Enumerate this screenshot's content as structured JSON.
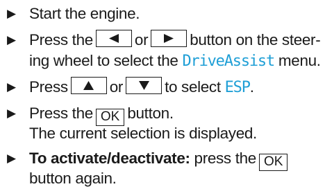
{
  "steps": [
    {
      "text": "Start the engine."
    },
    {
      "pre": "Press the",
      "key_left_icon": "triangle-left-icon",
      "or": "or",
      "key_right_icon": "triangle-right-icon",
      "post": "button on the steer-",
      "line2_pre": "ing wheel to select the",
      "menu": "DriveAssist",
      "line2_post": "menu."
    },
    {
      "pre": "Press",
      "key_up_icon": "triangle-up-icon",
      "or": "or",
      "key_down_icon": "triangle-down-icon",
      "mid": "to select",
      "item": "ESP",
      "post": "."
    },
    {
      "pre": "Press the",
      "key": "OK",
      "post": "button.",
      "line2": "The current selection is displayed."
    },
    {
      "label": "To activate/deactivate:",
      "pre": "press the",
      "key": "OK",
      "line2": "button again."
    }
  ],
  "bullet_icon": "triangle-bullet-icon",
  "colors": {
    "text": "#1a1a1a",
    "display_text": "#1f9fd6"
  }
}
